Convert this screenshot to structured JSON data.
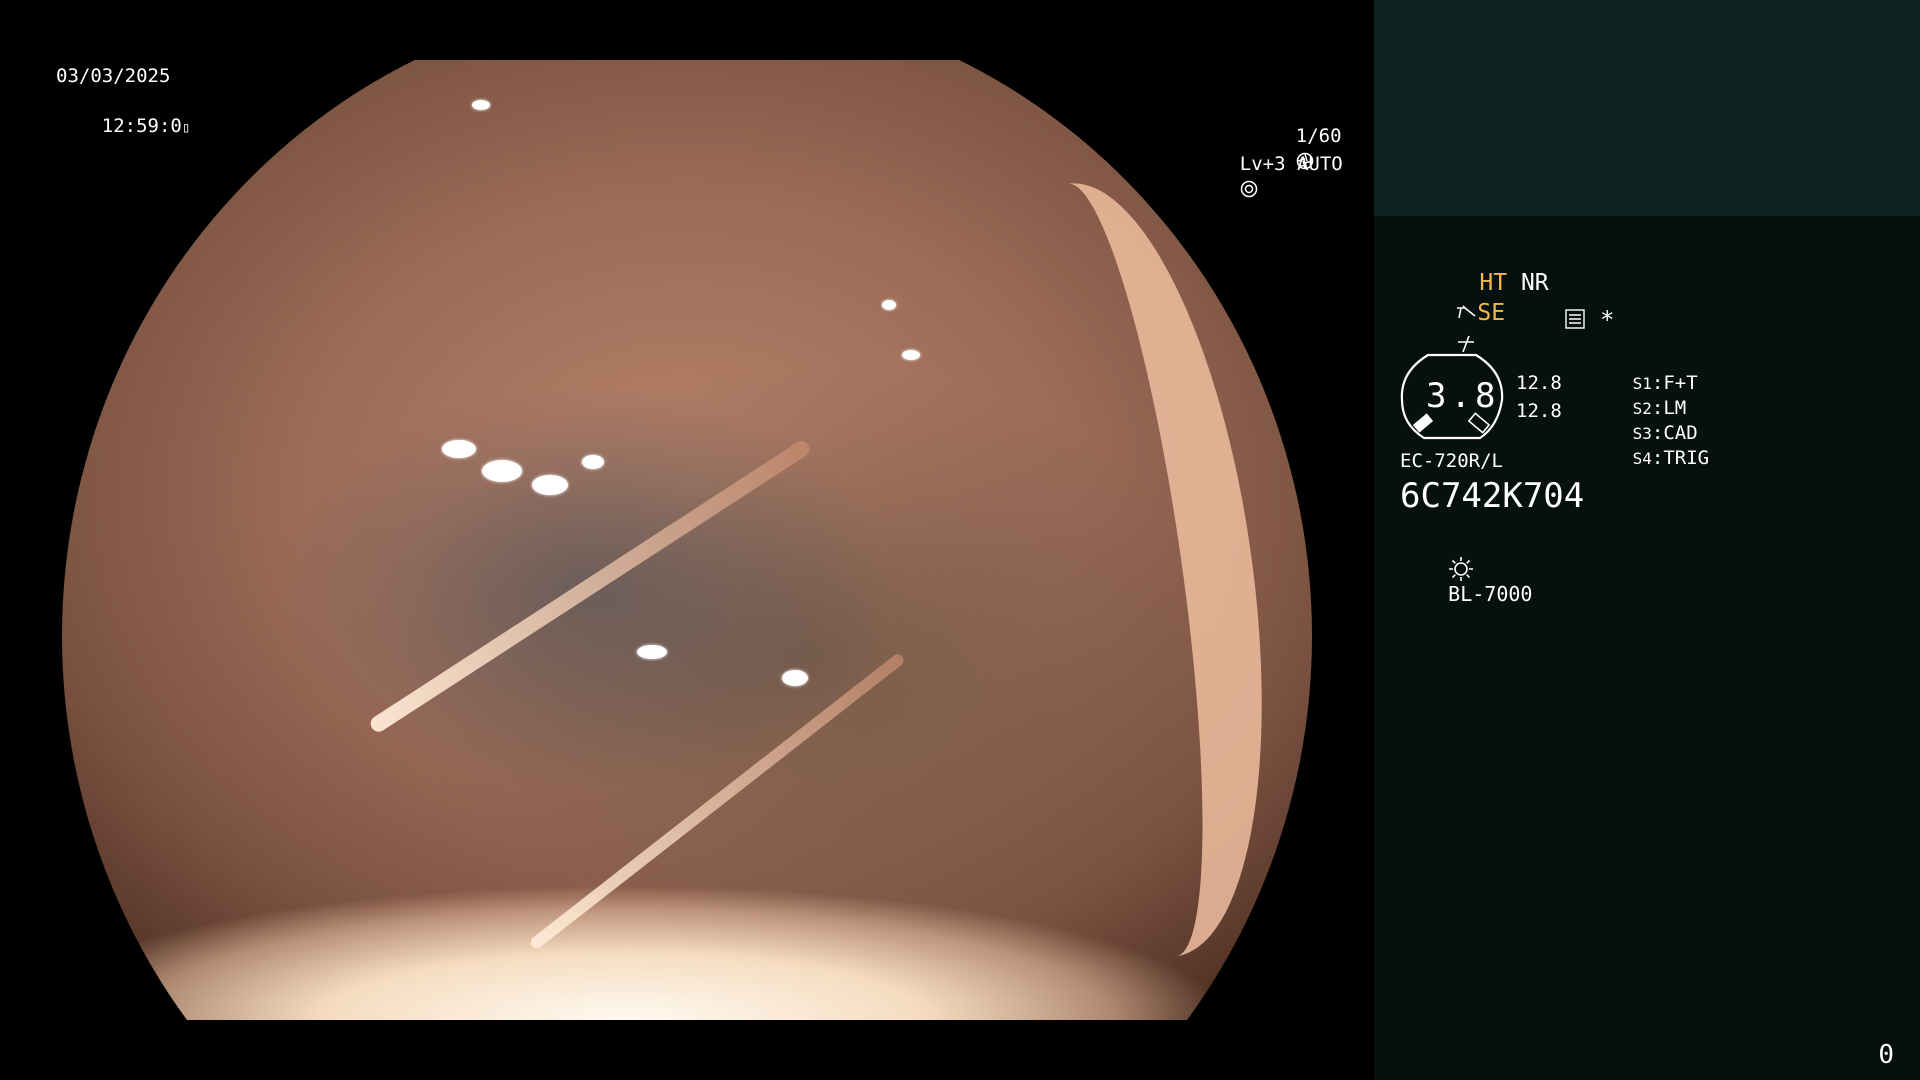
{
  "overlay": {
    "date": "03/03/2025",
    "time": "12:59:0",
    "shutter": "1/60",
    "level": "Lv+3",
    "auto": "AUTO"
  },
  "panel": {
    "ht": "HT",
    "nr": "NR",
    "se": "SE",
    "star": "*",
    "meter_value": "3.8",
    "meter_top": "12.8",
    "meter_bottom": "12.8",
    "switches": [
      {
        "key": "S1",
        "value": "F+T"
      },
      {
        "key": "S2",
        "value": "LM"
      },
      {
        "key": "S3",
        "value": "CAD"
      },
      {
        "key": "S4",
        "value": "TRIG"
      }
    ],
    "scope_model": "EC-720R/L",
    "scope_serial": "6C742K704",
    "light_source": "BL-7000",
    "counter": "0"
  },
  "colors": {
    "panel_bg": "#06110f",
    "panel_top_bg": "#0d2320",
    "amber": "#f5b84a"
  },
  "icons": [
    "aperture-icon",
    "iris-icon",
    "scope-se-icon",
    "enhance-icon",
    "menu-icon",
    "light-bulb-icon"
  ]
}
